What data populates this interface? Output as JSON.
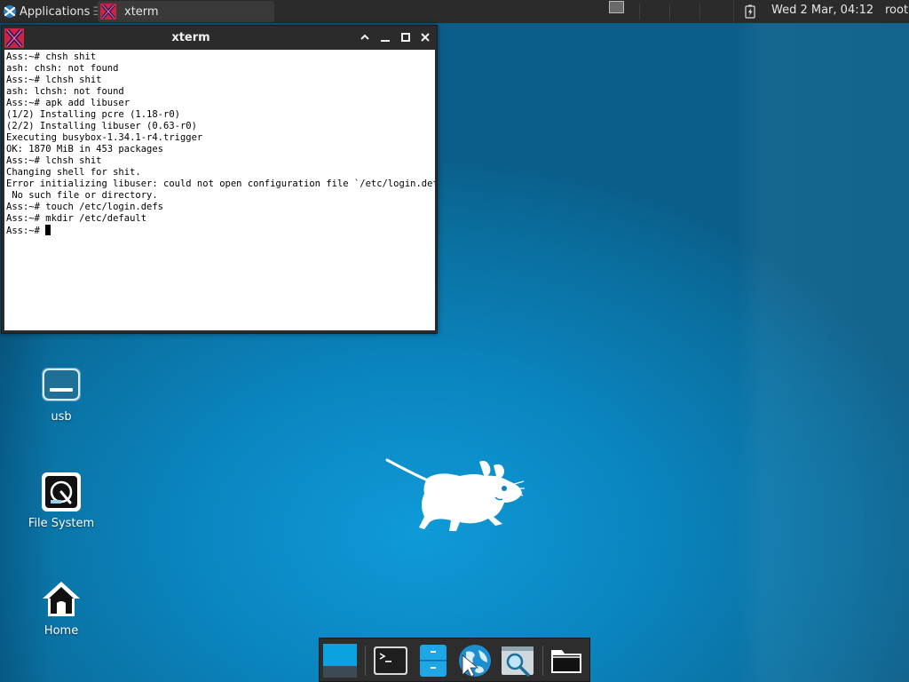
{
  "top_panel": {
    "applications_label": "Applications",
    "applications_sep": "☰",
    "task_title": "xterm",
    "clock": "Wed  2 Mar, 04:12",
    "user": "root"
  },
  "xterm": {
    "title": "xterm",
    "lines": [
      "Ass:~# chsh shit",
      "ash: chsh: not found",
      "Ass:~# lchsh shit",
      "ash: lchsh: not found",
      "Ass:~# apk add libuser",
      "(1/2) Installing pcre (1.18-r0)",
      "(2/2) Installing libuser (0.63-r0)",
      "Executing busybox-1.34.1-r4.trigger",
      "OK: 1870 MiB in 453 packages",
      "Ass:~# lchsh shit",
      "Changing shell for shit.",
      "Error initializing libuser: could not open configuration file `/etc/login.defs':",
      " No such file or directory.",
      "Ass:~# touch /etc/login.defs",
      "Ass:~# mkdir /etc/default"
    ],
    "prompt": "Ass:~# "
  },
  "desktop": {
    "icons": [
      {
        "label": "usb",
        "icon": "usb-drive-icon"
      },
      {
        "label": "File System",
        "icon": "filesystem-icon"
      },
      {
        "label": "Home",
        "icon": "home-icon"
      }
    ]
  },
  "dock": {
    "items": [
      {
        "icon": "show-desktop-icon"
      },
      {
        "icon": "terminal-icon"
      },
      {
        "icon": "file-manager-icon"
      },
      {
        "icon": "web-browser-icon"
      },
      {
        "icon": "app-finder-icon"
      },
      {
        "icon": "folder-icon"
      }
    ]
  },
  "colors": {
    "panel_bg": "#2b2b2b",
    "desktop_blue": "#0a84be",
    "terminal_bg": "#ffffff",
    "dock_bg": "#2d2d2d"
  }
}
